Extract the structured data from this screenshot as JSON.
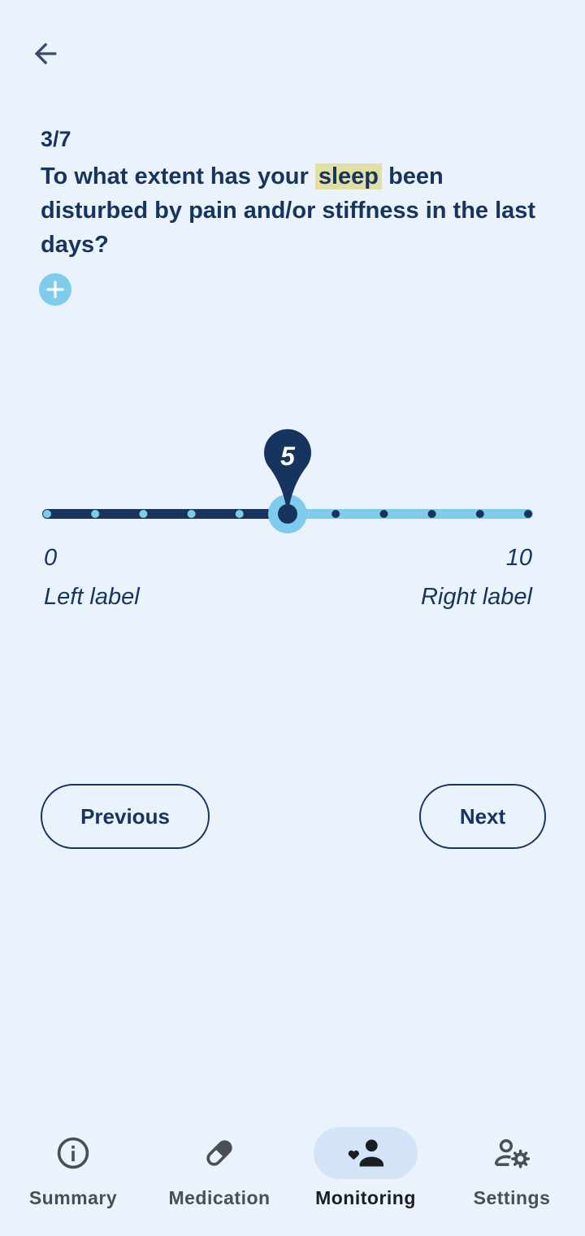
{
  "header": {
    "back_icon": "arrow-left-icon"
  },
  "question": {
    "progress": "3/7",
    "text_before": "To what extent has your ",
    "highlight": "sleep",
    "text_after": " been disturbed by pain and/or stiffness in the last days?"
  },
  "add_icon": "plus-circle-icon",
  "slider": {
    "min": 0,
    "max": 10,
    "value": 5,
    "value_label": "5",
    "min_label": "0",
    "max_label": "10",
    "left_label": "Left label",
    "right_label": "Right label",
    "colors": {
      "active": "#17345F",
      "inactive": "#7FCBEB"
    }
  },
  "actions": {
    "previous": "Previous",
    "next": "Next"
  },
  "nav": {
    "items": [
      {
        "label": "Summary",
        "icon": "info-circle-icon",
        "active": false
      },
      {
        "label": "Medication",
        "icon": "pill-icon",
        "active": false
      },
      {
        "label": "Monitoring",
        "icon": "heart-person-icon",
        "active": true
      },
      {
        "label": "Settings",
        "icon": "person-gear-icon",
        "active": false
      }
    ]
  },
  "colors": {
    "background": "#EAF2FB",
    "primary": "#17345F",
    "accent": "#7FCBEB",
    "highlight": "#E2DFA4"
  }
}
